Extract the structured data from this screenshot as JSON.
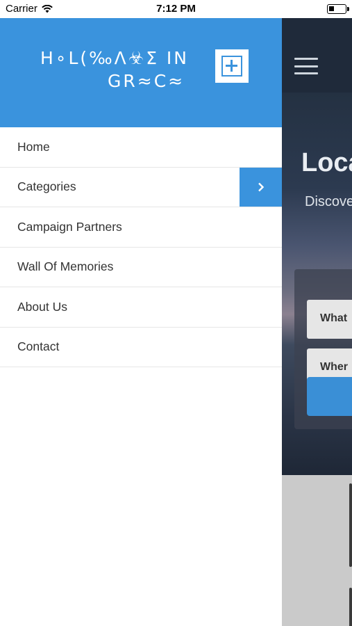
{
  "status_bar": {
    "carrier": "Carrier",
    "time": "7:12 PM"
  },
  "drawer": {
    "logo": {
      "line1": "H∘L(‰Λ☣Σ IN",
      "line2": "GR≈C≈"
    },
    "menu": [
      {
        "label": "Home",
        "has_submenu": false
      },
      {
        "label": "Categories",
        "has_submenu": true
      },
      {
        "label": "Campaign Partners",
        "has_submenu": false
      },
      {
        "label": "Wall Of Memories",
        "has_submenu": false
      },
      {
        "label": "About Us",
        "has_submenu": false
      },
      {
        "label": "Contact",
        "has_submenu": false
      }
    ]
  },
  "background_page": {
    "hero_title": "Loca",
    "hero_subtitle": "Discove",
    "field_what": "What",
    "field_when": "Wher"
  },
  "colors": {
    "accent": "#3a93dd",
    "menu_text": "#333333",
    "divider": "#e6e6e6"
  }
}
